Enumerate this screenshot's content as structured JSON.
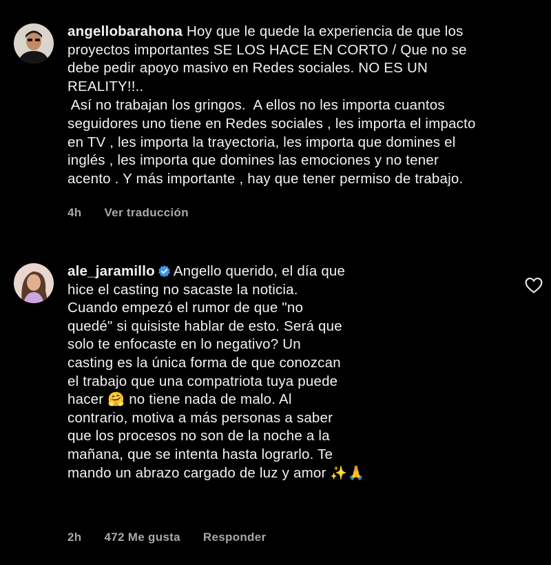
{
  "comments": [
    {
      "username": "angellobarahona",
      "text_lines": [
        "Hoy que le quede la experiencia de que los",
        "proyectos importantes SE LOS HACE EN CORTO / Que no se",
        "debe pedir apoyo masivo en Redes sociales. NO ES UN",
        "REALITY!!..",
        " Así no trabajan los gringos.  A ellos no les importa cuantos",
        "seguidores uno tiene en Redes sociales , les importa el impacto",
        "en TV , les importa la trayectoria, les importa que domines el",
        "inglés , les importa que domines las emociones y no tener",
        "acento . Y más importante , hay que tener permiso de trabajo."
      ],
      "time": "4h",
      "translate_label": "Ver traducción"
    },
    {
      "username": "ale_jaramillo",
      "verified_icon": "verified-badge-icon",
      "text_lines": [
        "Angello querido, el día que",
        "hice el casting no sacaste la noticia.",
        "Cuando empezó el rumor de que \"no",
        "quedé\" si quisiste hablar de esto. Será que",
        "solo te enfocaste en lo negativo? Un",
        "casting es la única forma de que conozcan",
        "el trabajo que una compatriota tuya puede",
        "hacer",
        "no tiene nada de malo. Al",
        "contrario, motiva a más personas a saber",
        "que los procesos no son de la noche a la",
        "mañana, que se intenta hasta lograrlo. Te",
        "mando un abrazo cargado de luz y amor"
      ],
      "emoji_hug": "🤗",
      "emoji_end": "✨🙏",
      "time": "2h",
      "likes_label": "472 Me gusta",
      "reply_label": "Responder",
      "like_icon": "heart-outline-icon"
    }
  ],
  "colors": {
    "background": "#000000",
    "text": "#f2f2f2",
    "meta": "#a8a8a8",
    "verified": "#3897f0"
  }
}
